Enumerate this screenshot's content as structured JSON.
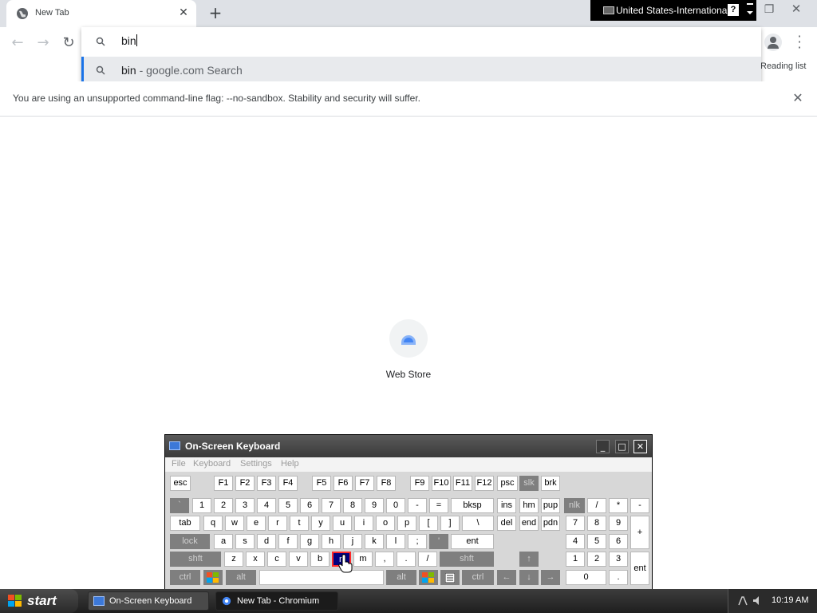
{
  "browser": {
    "tab_title": "New Tab",
    "new_tab_symbol": "+",
    "language_bar": "United States-International",
    "language_help": "?",
    "omnibox": {
      "input_text": "bin",
      "suggestion_query": "bin",
      "suggestion_suffix": " - google.com Search"
    },
    "reading_list_label": "Reading list",
    "infobar_text": "You are using an unsupported command-line flag: --no-sandbox. Stability and security will suffer.",
    "shortcut_label": "Web Store"
  },
  "osk": {
    "title": "On-Screen Keyboard",
    "menu": [
      "File",
      "Keyboard",
      "Settings",
      "Help"
    ],
    "pressed_key": "n"
  },
  "taskbar": {
    "start_label": "start",
    "tasks": [
      "On-Screen Keyboard",
      "New Tab - Chromium"
    ],
    "clock": "10:19 AM"
  },
  "colors": {
    "accent": "#1a73e8",
    "pressed_key_bg": "#000080",
    "pressed_key_border": "#ff2a2a"
  },
  "keys": {
    "esc": "esc",
    "F1": "F1",
    "F2": "F2",
    "F3": "F3",
    "F4": "F4",
    "F5": "F5",
    "F6": "F6",
    "F7": "F7",
    "F8": "F8",
    "F9": "F9",
    "F10": "F10",
    "F11": "F11",
    "F12": "F12",
    "psc": "psc",
    "slk": "slk",
    "brk": "brk",
    "backtick": "`",
    "k1": "1",
    "k2": "2",
    "k3": "3",
    "k4": "4",
    "k5": "5",
    "k6": "6",
    "k7": "7",
    "k8": "8",
    "k9": "9",
    "k0": "0",
    "minus": "-",
    "equals": "=",
    "bksp": "bksp",
    "ins": "ins",
    "hm": "hm",
    "pup": "pup",
    "nlk": "nlk",
    "np_slash": "/",
    "np_star": "*",
    "np_minus": "-",
    "tab": "tab",
    "q": "q",
    "w": "w",
    "e": "e",
    "r": "r",
    "t": "t",
    "y": "y",
    "u": "u",
    "i": "i",
    "o": "o",
    "p": "p",
    "lbracket": "[",
    "rbracket": "]",
    "backslash": "\\",
    "del": "del",
    "end": "end",
    "pdn": "pdn",
    "np7": "7",
    "np8": "8",
    "np9": "9",
    "np_plus": "+",
    "lock": "lock",
    "a": "a",
    "s": "s",
    "d": "d",
    "f": "f",
    "g": "g",
    "h": "h",
    "j": "j",
    "k": "k",
    "l": "l",
    "semicolon": ";",
    "quote": "'",
    "ent": "ent",
    "np4": "4",
    "np5": "5",
    "np6": "6",
    "lshft": "shft",
    "z": "z",
    "x": "x",
    "c": "c",
    "v": "v",
    "b": "b",
    "n": "n",
    "m": "m",
    "comma": ",",
    "period": ".",
    "slash": "/",
    "rshft": "shft",
    "up": "↑",
    "np1": "1",
    "np2": "2",
    "np3": "3",
    "np_ent": "ent",
    "lctrl": "ctrl",
    "lalt": "alt",
    "ralt": "alt",
    "rctrl": "ctrl",
    "left": "←",
    "down": "↓",
    "right": "→",
    "np0": "0",
    "np_dot": "."
  }
}
